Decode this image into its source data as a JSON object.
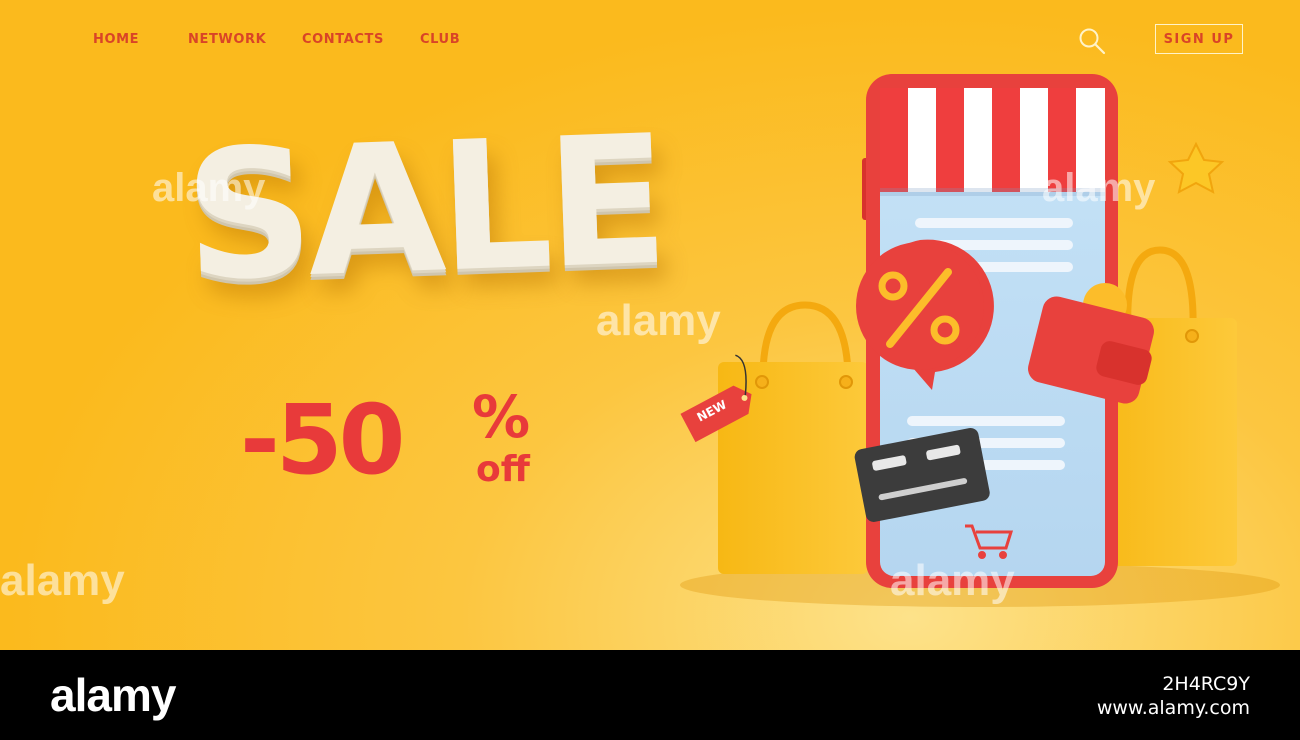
{
  "nav": {
    "items": [
      {
        "label": "HOME"
      },
      {
        "label": "NETWORK"
      },
      {
        "label": "CONTACTS"
      },
      {
        "label": "CLUB"
      }
    ],
    "search_icon": "search-icon",
    "signup_label": "SIGN UP"
  },
  "hero": {
    "headline": "SALE",
    "discount": "-50",
    "percent_sign": "%",
    "off_label": "off",
    "tag_label": "NEW"
  },
  "colors": {
    "background": "#fbba1d",
    "accent_red": "#e83a3a",
    "nav_text": "#d94427"
  },
  "watermark": {
    "text": "alamy"
  },
  "footer": {
    "logo": "alamy",
    "image_id": "2H4RC9Y",
    "url": "www.alamy.com"
  }
}
